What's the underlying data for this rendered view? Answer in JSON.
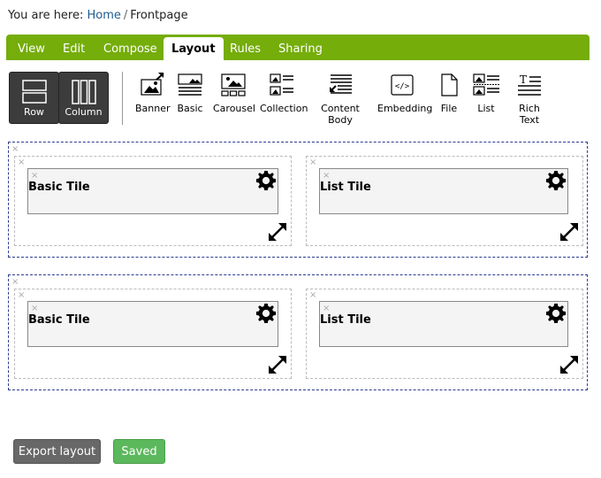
{
  "breadcrumb": {
    "prefix": "You are here:",
    "home": "Home",
    "separator": "/",
    "current": "Frontpage"
  },
  "tabs": [
    {
      "label": "View"
    },
    {
      "label": "Edit"
    },
    {
      "label": "Compose"
    },
    {
      "label": "Layout",
      "active": true
    },
    {
      "label": "Rules"
    },
    {
      "label": "Sharing"
    }
  ],
  "layout_buttons": [
    {
      "label": "Row",
      "icon": "row-icon"
    },
    {
      "label": "Column",
      "icon": "column-icon"
    }
  ],
  "tile_types": [
    {
      "label": "Banner",
      "icon": "banner-icon"
    },
    {
      "label": "Basic",
      "icon": "basic-icon"
    },
    {
      "label": "Carousel",
      "icon": "carousel-icon"
    },
    {
      "label": "Collection",
      "icon": "collection-icon"
    },
    {
      "label": "Content Body",
      "icon": "content-body-icon"
    },
    {
      "label": "Embedding",
      "icon": "embedding-icon",
      "glyph": "</>"
    },
    {
      "label": "File",
      "icon": "file-icon"
    },
    {
      "label": "List",
      "icon": "list-icon"
    },
    {
      "label": "Rich Text",
      "icon": "rich-text-icon",
      "glyph": "T"
    }
  ],
  "close_glyph": "×",
  "rows": [
    {
      "tiles": [
        {
          "title": "Basic Tile"
        },
        {
          "title": "List Tile"
        }
      ]
    },
    {
      "tiles": [
        {
          "title": "Basic Tile"
        },
        {
          "title": "List Tile"
        }
      ]
    }
  ],
  "footer": {
    "export_label": "Export layout",
    "saved_label": "Saved"
  },
  "colors": {
    "tabbar": "#75ad0a",
    "row_border": "#2d3c8f",
    "saved": "#5cb85c",
    "export": "#686868",
    "link": "#205c90"
  }
}
